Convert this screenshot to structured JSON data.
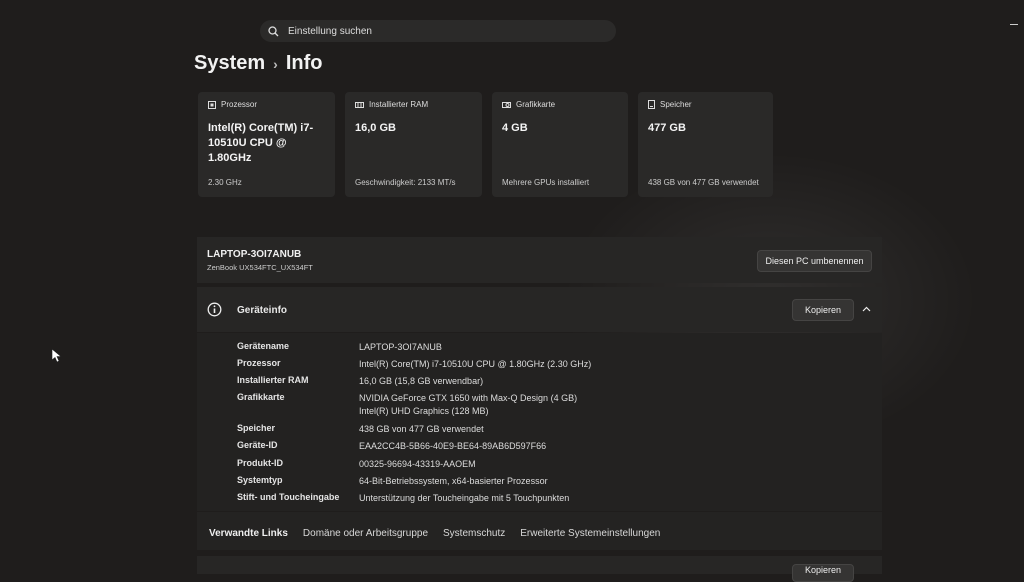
{
  "search": {
    "placeholder": "Einstellung suchen"
  },
  "breadcrumb": {
    "section": "System",
    "page": "Info"
  },
  "cards": [
    {
      "icon": "processor-icon",
      "label": "Prozessor",
      "value": "Intel(R) Core(TM) i7-10510U CPU @ 1.80GHz",
      "footer": "2.30 GHz"
    },
    {
      "icon": "ram-icon",
      "label": "Installierter RAM",
      "value": "16,0 GB",
      "footer": "Geschwindigkeit: 2133 MT/s"
    },
    {
      "icon": "gpu-icon",
      "label": "Grafikkarte",
      "value": "4 GB",
      "footer": "Mehrere GPUs installiert"
    },
    {
      "icon": "storage-icon",
      "label": "Speicher",
      "value": "477 GB",
      "footer": "438 GB von 477 GB verwendet"
    }
  ],
  "device_header": {
    "name": "LAPTOP-3OI7ANUB",
    "model": "ZenBook UX534FTC_UX534FT",
    "rename_label": "Diesen PC umbenennen"
  },
  "device_info": {
    "title": "Geräteinfo",
    "copy_label": "Kopieren",
    "rows": [
      {
        "label": "Gerätename",
        "value": "LAPTOP-3OI7ANUB"
      },
      {
        "label": "Prozessor",
        "value": "Intel(R) Core(TM) i7-10510U CPU @ 1.80GHz (2.30 GHz)"
      },
      {
        "label": "Installierter RAM",
        "value": "16,0 GB (15,8 GB verwendbar)"
      },
      {
        "label": "Grafikkarte",
        "value": "NVIDIA GeForce GTX 1650 with Max-Q Design (4 GB)",
        "value2": "Intel(R) UHD Graphics (128 MB)"
      },
      {
        "label": "Speicher",
        "value": "438 GB von 477 GB verwendet"
      },
      {
        "label": "Geräte-ID",
        "value": "EAA2CC4B-5B66-40E9-BE64-89AB6D597F66"
      },
      {
        "label": "Produkt-ID",
        "value": "00325-96694-43319-AAOEM"
      },
      {
        "label": "Systemtyp",
        "value": "64-Bit-Betriebssystem, x64-basierter Prozessor"
      },
      {
        "label": "Stift- und Toucheingabe",
        "value": "Unterstützung der Toucheingabe mit 5 Touchpunkten"
      }
    ]
  },
  "related_links": {
    "title": "Verwandte Links",
    "items": [
      "Domäne oder Arbeitsgruppe",
      "Systemschutz",
      "Erweiterte Systemeinstellungen"
    ]
  },
  "bottom_button": {
    "label": "Kopieren"
  }
}
